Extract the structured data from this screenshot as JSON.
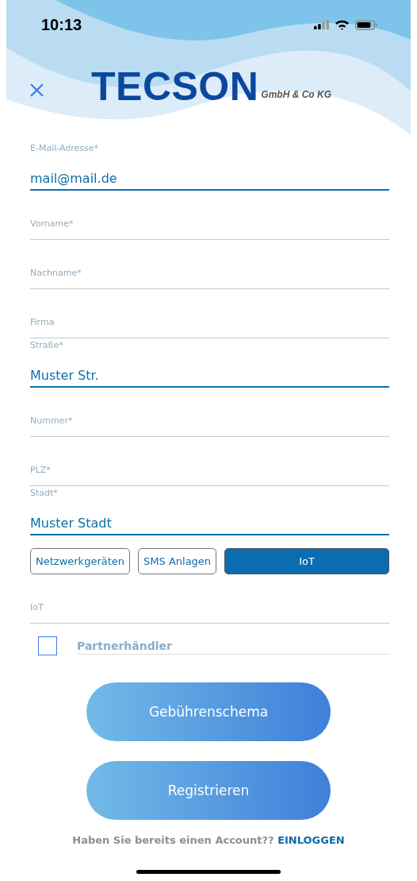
{
  "status_bar": {
    "time": "10:13"
  },
  "header": {
    "logo": "TECSON",
    "logo_suffix": "GmbH & Co KG"
  },
  "fields": [
    {
      "label": "E-Mail-Adresse*",
      "value": "mail@mail.de"
    },
    {
      "label": "Vorname*"
    },
    {
      "label": "Nachname*"
    },
    {
      "label": "Firma"
    },
    {
      "label": "Straße*",
      "value": "Muster Str."
    },
    {
      "label": "Nummer*"
    },
    {
      "label": "PLZ*"
    },
    {
      "label": "Stadt*",
      "value": "Muster Stadt"
    }
  ],
  "categories": [
    {
      "label": "Netzwerkgeräten",
      "selected": false
    },
    {
      "label": "SMS Anlagen",
      "selected": false
    },
    {
      "label": "IoT",
      "selected": true
    }
  ],
  "category_field": {
    "label": "IoT"
  },
  "partner": {
    "label": "Partnerhändler",
    "checked": false
  },
  "buttons": [
    "Gebührenschema",
    "Registrieren"
  ],
  "footer": {
    "text": "Haben Sie bereits einen Account??",
    "link": "EINLOGGEN"
  }
}
